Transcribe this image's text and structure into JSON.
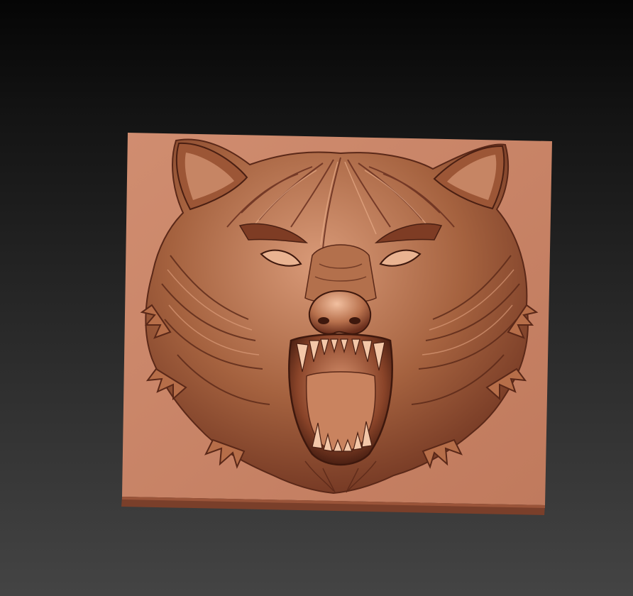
{
  "scene": {
    "subject": "wolf-head-relief",
    "colors": {
      "background_top": "#050505",
      "background_bottom": "#444444",
      "plate_face": "#c8856a",
      "plate_edge": "#7a3f2a",
      "relief_highlight": "#f0b896",
      "relief_mid": "#a5623f",
      "relief_shadow": "#4a1f12"
    }
  }
}
